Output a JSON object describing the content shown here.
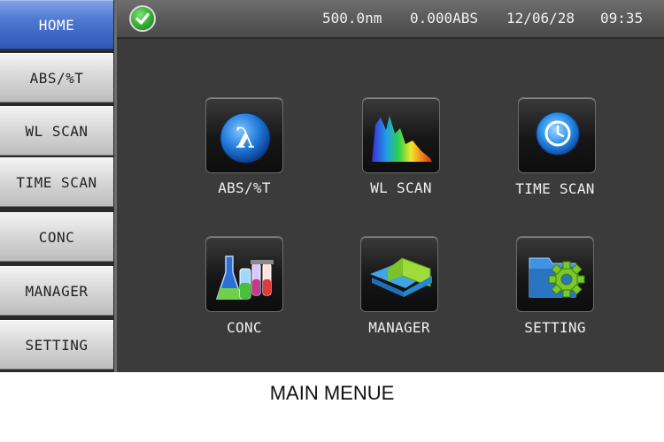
{
  "sidebar": {
    "items": [
      {
        "label": "HOME",
        "active": true
      },
      {
        "label": "ABS/%T",
        "active": false
      },
      {
        "label": "WL SCAN",
        "active": false
      },
      {
        "label": "TIME SCAN",
        "active": false
      },
      {
        "label": "CONC",
        "active": false
      },
      {
        "label": "MANAGER",
        "active": false
      },
      {
        "label": "SETTING",
        "active": false
      }
    ]
  },
  "status": {
    "wavelength": "500.0nm",
    "absorbance": "0.000ABS",
    "date": "12/06/28",
    "time": "09:35",
    "indicator_icon": "check-circle-icon"
  },
  "tiles": [
    {
      "label": "ABS/%T",
      "icon": "lambda-icon"
    },
    {
      "label": "WL SCAN",
      "icon": "spectrum-icon"
    },
    {
      "label": "TIME SCAN",
      "icon": "clock-icon"
    },
    {
      "label": "CONC",
      "icon": "flasks-icon"
    },
    {
      "label": "MANAGER",
      "icon": "folder-icon"
    },
    {
      "label": "SETTING",
      "icon": "gear-folder-icon"
    }
  ],
  "caption": "MAIN MENUE",
  "colors": {
    "active_sidebar": "#3f66c4",
    "screen_bg": "#3b3b3b",
    "status_ok": "#2ea52a"
  }
}
